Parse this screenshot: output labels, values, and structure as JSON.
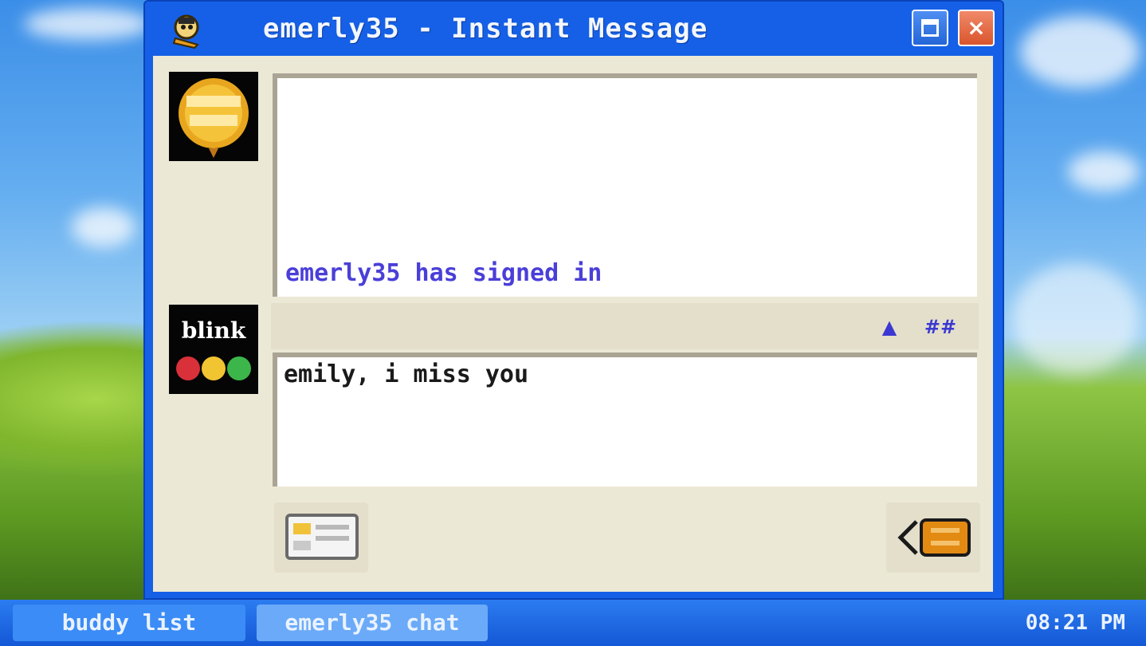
{
  "window": {
    "title": "emerly35 - Instant Message",
    "minimize_icon": "minimize-icon",
    "close_label": "×"
  },
  "buddy": {
    "avatar_icon": "buddy-avatar-icon",
    "avatar_logo": "lettering logo (illegible, reproduced as picture)"
  },
  "self": {
    "avatar_icon": "blink-avatar-icon",
    "avatar_word": "blink"
  },
  "conversation": {
    "lines": [
      {
        "text": "emerly35 has signed in",
        "color": "#4a3fd8"
      }
    ]
  },
  "toolbar": {
    "font_button": "▲",
    "font_button_icon": "font-color-icon",
    "size_button": "##",
    "size_button_icon": "font-size-icon"
  },
  "compose": {
    "text": "emily, i miss you"
  },
  "buttons": {
    "profile_icon": "profile-card-icon",
    "send_icon": "send-icon"
  },
  "taskbar": {
    "items": [
      {
        "label": "buddy list"
      },
      {
        "label": "emerly35 chat"
      }
    ],
    "clock": "08:21 PM"
  },
  "colors": {
    "titlebar": "#1560e6",
    "client": "#ece8d6",
    "status_text": "#4a3fd8",
    "close_button": "#d9552c",
    "send_button": "#e38a12"
  }
}
